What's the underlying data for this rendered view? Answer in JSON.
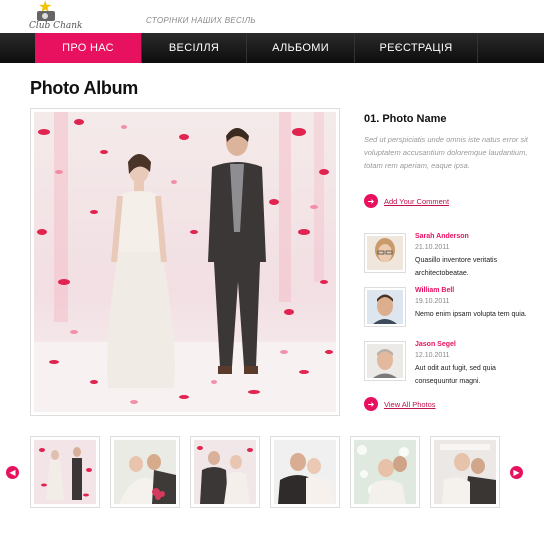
{
  "brand": {
    "logo_text": "Club Chank",
    "tagline": "СТОРІНКИ НАШИХ ВЕСІЛЬ"
  },
  "nav": {
    "items": [
      {
        "label": "ПРО НАС",
        "active": true
      },
      {
        "label": "ВЕСІЛЛЯ",
        "active": false
      },
      {
        "label": "АЛЬБОМИ",
        "active": false
      },
      {
        "label": "РЕЄСТРАЦІЯ",
        "active": false
      }
    ]
  },
  "page": {
    "title": "Photo Album"
  },
  "photo": {
    "name": "01. Photo Name",
    "description": "Sed ut perspiciatis unde omnis iste natus error sit voluptatem accusantium doloremque laudantium, totam rem aperiam, eaque ipsa.",
    "add_comment_label": "Add Your Comment",
    "view_all_label": "View All Photos"
  },
  "comments": [
    {
      "name": "Sarah Anderson",
      "date": "21.10.2011",
      "text": "Quasillo inventore veritatis architectobeatae."
    },
    {
      "name": "William Bell",
      "date": "19.10.2011",
      "text": "Nemo enim ipsam volupta tem quia."
    },
    {
      "name": "Jason Segel",
      "date": "12.10.2011",
      "text": "Aut odit aut fugit, sed quia consequuntur magni."
    }
  ],
  "thumbnails_count": 6,
  "icons": {
    "arrow_right": "arrow-right-icon",
    "arrow_left": "arrow-left-icon",
    "star": "star-icon",
    "camera": "camera-icon"
  },
  "colors": {
    "accent": "#e8115f",
    "nav_bg": "#111111",
    "petal": "#e0234f"
  }
}
